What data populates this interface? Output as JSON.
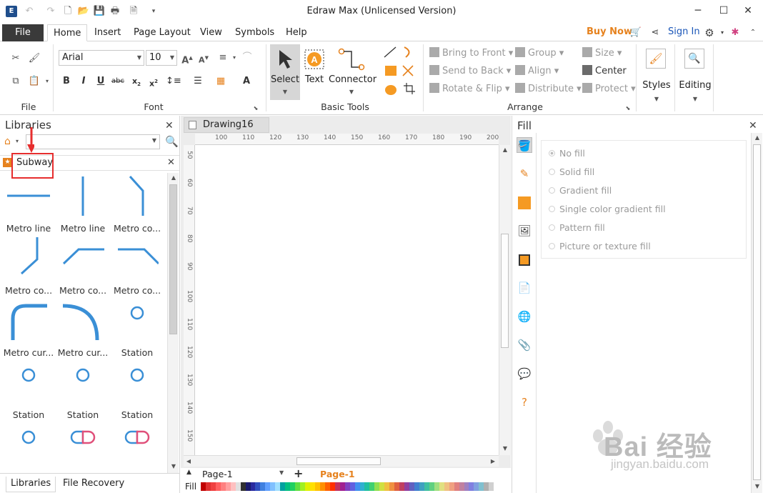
{
  "window": {
    "title": "Edraw Max (Unlicensed Version)"
  },
  "menu": {
    "file": "File",
    "tabs": [
      "Home",
      "Insert",
      "Page Layout",
      "View",
      "Symbols",
      "Help"
    ],
    "buy_now": "Buy Now",
    "sign_in": "Sign In"
  },
  "ribbon": {
    "groups": {
      "file": "File",
      "font": "Font",
      "basic_tools": "Basic Tools",
      "arrange": "Arrange"
    },
    "font_name": "Arial",
    "font_size": "10",
    "select": "Select",
    "text": "Text",
    "connector": "Connector",
    "arrange": {
      "bring_to_front": "Bring to Front",
      "send_to_back": "Send to Back",
      "rotate_flip": "Rotate & Flip",
      "group": "Group",
      "align": "Align",
      "distribute": "Distribute",
      "size": "Size",
      "center": "Center",
      "protect": "Protect"
    },
    "styles": "Styles",
    "editing": "Editing"
  },
  "libraries": {
    "title": "Libraries",
    "search_value": "",
    "current_library": "Subway",
    "shapes": [
      {
        "label": "Metro line",
        "shape": "h-line"
      },
      {
        "label": "Metro line",
        "shape": "v-line"
      },
      {
        "label": "Metro co...",
        "shape": "corner-down"
      },
      {
        "label": "Metro co...",
        "shape": "corner-up"
      },
      {
        "label": "Metro co...",
        "shape": "corner-rise"
      },
      {
        "label": "Metro co...",
        "shape": "corner-fall"
      },
      {
        "label": "Metro cur...",
        "shape": "curve-left"
      },
      {
        "label": "Metro cur...",
        "shape": "curve-right"
      },
      {
        "label": "Station",
        "shape": "station"
      },
      {
        "label": "Station",
        "shape": "station"
      },
      {
        "label": "Station",
        "shape": "station"
      },
      {
        "label": "Station",
        "shape": "station"
      },
      {
        "label": "",
        "shape": "station"
      },
      {
        "label": "",
        "shape": "pill"
      },
      {
        "label": "",
        "shape": "pill"
      }
    ],
    "tabs": [
      "Libraries",
      "File Recovery"
    ]
  },
  "canvas": {
    "doc_tab": "Drawing16",
    "ruler_top": [
      "100",
      "110",
      "120",
      "130",
      "140",
      "150",
      "160",
      "170",
      "180",
      "190",
      "200"
    ],
    "ruler_left": [
      "50",
      "60",
      "70",
      "80",
      "90",
      "100",
      "110",
      "120",
      "130",
      "140",
      "150"
    ],
    "page_select": "Page-1",
    "active_page": "Page-1",
    "fill_label": "Fill"
  },
  "fill_panel": {
    "title": "Fill",
    "options": [
      "No fill",
      "Solid fill",
      "Gradient fill",
      "Single color gradient fill",
      "Pattern fill",
      "Picture or texture fill"
    ],
    "selected": "No fill"
  },
  "watermark": {
    "text": "Bai 经验",
    "sub": "jingyan.baidu.com"
  },
  "colors": {
    "accent": "#e6821e",
    "metro_blue": "#3a8fd6",
    "highlight_red": "#e62e2e",
    "pill_pink": "#e0507a",
    "swatches": [
      "#c00000",
      "#e03030",
      "#f04040",
      "#ff6060",
      "#ff8080",
      "#ffa0a0",
      "#ffc0c0",
      "#e0e0e0",
      "#303030",
      "#1a1a6e",
      "#2a2aa0",
      "#3050c0",
      "#4080e0",
      "#60a0ff",
      "#80c0ff",
      "#a0e0ff",
      "#00a0a0",
      "#00c080",
      "#20d060",
      "#60e040",
      "#a0f020",
      "#e0f000",
      "#ffe000",
      "#ffc000",
      "#ff9000",
      "#ff6000",
      "#ff3000",
      "#c03060",
      "#a02090",
      "#8040c0",
      "#6060e0",
      "#4090f0",
      "#30b0d0",
      "#20c0a0",
      "#40d070",
      "#90e050",
      "#d0e040",
      "#f0c040",
      "#f09040",
      "#e06040",
      "#c04060",
      "#9040a0",
      "#6060c0",
      "#4080d0",
      "#40a0c0",
      "#40c0a0",
      "#60d080",
      "#a0e080",
      "#e0e080",
      "#f0c080",
      "#f0a080",
      "#e08080",
      "#c080a0",
      "#a080c0",
      "#8080e0",
      "#80a0e0",
      "#80c0d0",
      "#b0b0b0",
      "#d0d0d0"
    ]
  }
}
